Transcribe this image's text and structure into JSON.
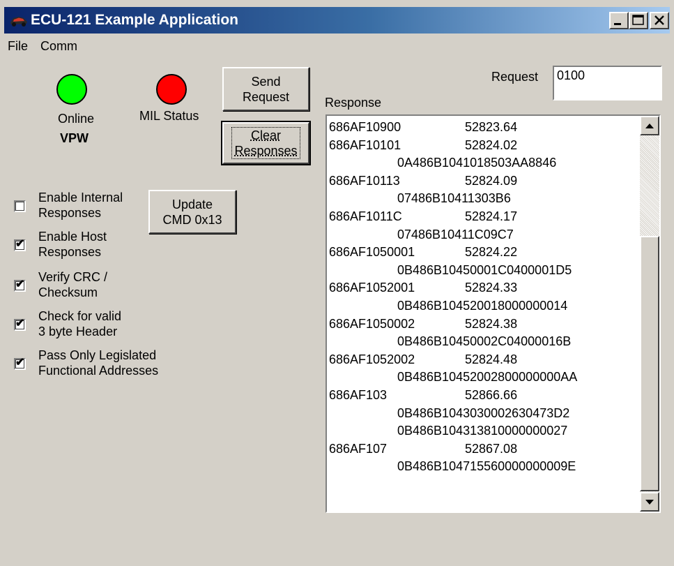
{
  "window": {
    "title": "ECU-121 Example Application"
  },
  "menu": [
    "File",
    "Comm"
  ],
  "indicators": {
    "online": {
      "label": "Online",
      "color": "#00ff00"
    },
    "mil": {
      "label": "MIL Status",
      "color": "#ff0000"
    },
    "protocol": "VPW"
  },
  "buttons": {
    "send_request": [
      "Send",
      "Request"
    ],
    "clear_responses": [
      "Clear",
      "Responses"
    ],
    "update_cmd": [
      "Update",
      "CMD 0x13"
    ]
  },
  "request": {
    "label": "Request",
    "value": "0100"
  },
  "response": {
    "label": "Response",
    "rows": [
      {
        "a": "686AF10900",
        "b": "52823.64",
        "c": ""
      },
      {
        "a": "686AF10101",
        "b": "52824.02",
        "c": ""
      },
      {
        "a": "",
        "b": "",
        "c": "0A486B1041018503AA8846"
      },
      {
        "a": "686AF10113",
        "b": "52824.09",
        "c": ""
      },
      {
        "a": "",
        "b": "",
        "c": "07486B10411303B6"
      },
      {
        "a": "686AF1011C",
        "b": "52824.17",
        "c": ""
      },
      {
        "a": "",
        "b": "",
        "c": "07486B10411C09C7"
      },
      {
        "a": "686AF1050001",
        "b": "52824.22",
        "c": ""
      },
      {
        "a": "",
        "b": "",
        "c": "0B486B10450001C0400001D5"
      },
      {
        "a": "686AF1052001",
        "b": "52824.33",
        "c": ""
      },
      {
        "a": "",
        "b": "",
        "c": "0B486B104520018000000014"
      },
      {
        "a": "686AF1050002",
        "b": "52824.38",
        "c": ""
      },
      {
        "a": "",
        "b": "",
        "c": "0B486B10450002C04000016B"
      },
      {
        "a": "686AF1052002",
        "b": "52824.48",
        "c": ""
      },
      {
        "a": "",
        "b": "",
        "c": "0B486B10452002800000000AA"
      },
      {
        "a": "686AF103",
        "b": "52866.66",
        "c": ""
      },
      {
        "a": "",
        "b": "",
        "c": "0B486B1043030002630473D2"
      },
      {
        "a": "",
        "b": "",
        "c": "0B486B104313810000000027"
      },
      {
        "a": "686AF107",
        "b": "52867.08",
        "c": ""
      },
      {
        "a": "",
        "b": "",
        "c": "0B486B104715560000000009E"
      }
    ]
  },
  "options": [
    {
      "lines": [
        "Enable Internal",
        "Responses"
      ],
      "checked": false
    },
    {
      "lines": [
        "Enable Host",
        "Responses"
      ],
      "checked": true
    },
    {
      "lines": [
        "Verify CRC /",
        "Checksum"
      ],
      "checked": true
    },
    {
      "lines": [
        "Check for valid",
        "3 byte Header"
      ],
      "checked": true
    },
    {
      "lines": [
        "Pass Only Legislated",
        "Functional Addresses"
      ],
      "checked": true
    }
  ],
  "check_mark": "✔",
  "icons": {
    "minimize": "minimize-icon",
    "maximize": "maximize-icon",
    "close": "close-icon",
    "app": "car-icon"
  }
}
